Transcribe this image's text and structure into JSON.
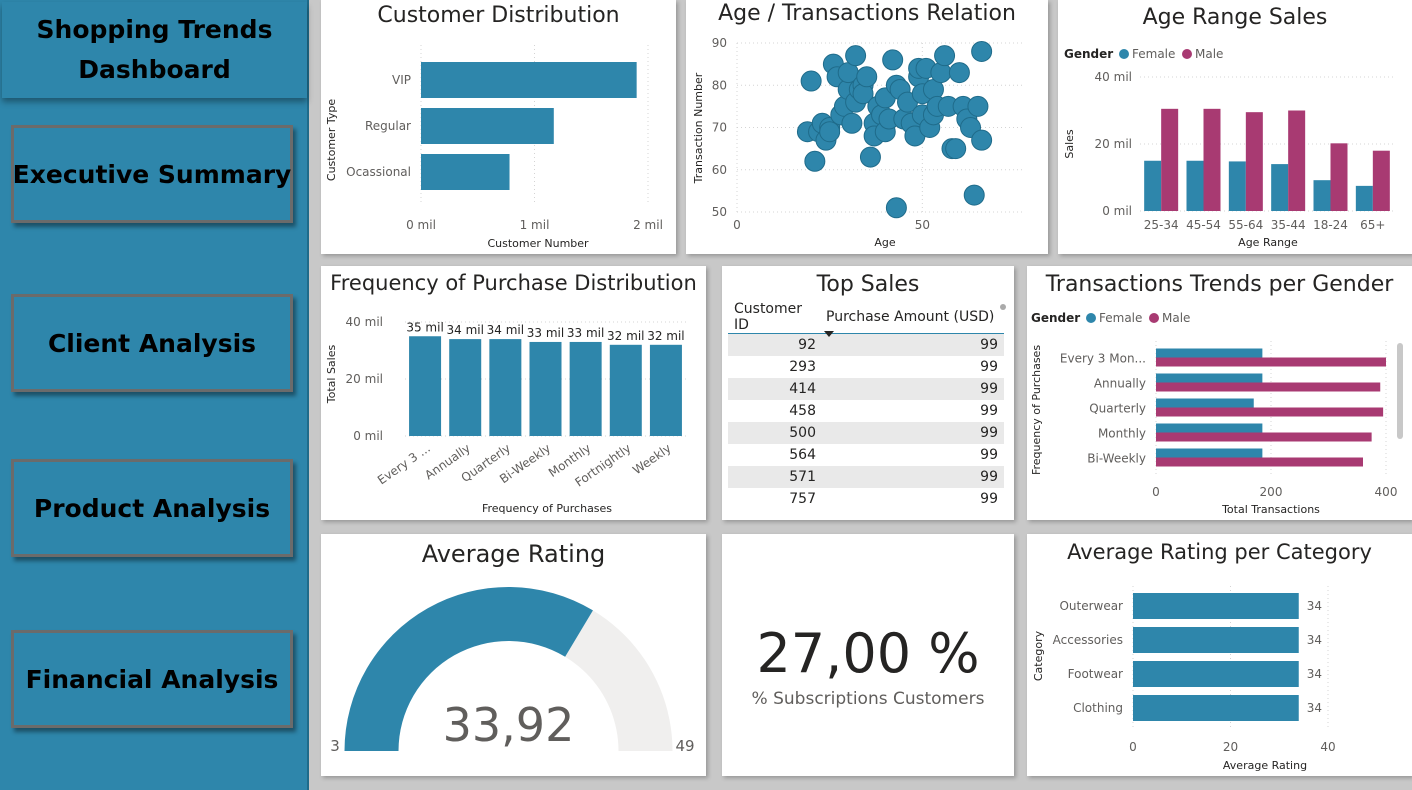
{
  "sidebar": {
    "title": "Shopping Trends\nDashboard",
    "nav": [
      {
        "label": "Executive Summary"
      },
      {
        "label": "Client Analysis"
      },
      {
        "label": "Product Analysis"
      },
      {
        "label": "Financial Analysis"
      }
    ]
  },
  "colors": {
    "primary": "#2e86ab",
    "male": "#a83a72",
    "female": "#2e86ab",
    "gauge_bg": "#f0efee"
  },
  "cards": {
    "customer_distribution": {
      "title": "Customer Distribution"
    },
    "age_transactions": {
      "title": "Age / Transactions Relation"
    },
    "age_range_sales": {
      "title": "Age Range Sales"
    },
    "frequency_purchase": {
      "title": "Frequency of Purchase Distribution"
    },
    "top_sales": {
      "title": "Top Sales",
      "columns": [
        "Customer ID",
        "Purchase Amount (USD)"
      ],
      "rows": [
        [
          "92",
          "99"
        ],
        [
          "293",
          "99"
        ],
        [
          "414",
          "99"
        ],
        [
          "458",
          "99"
        ],
        [
          "500",
          "99"
        ],
        [
          "564",
          "99"
        ],
        [
          "571",
          "99"
        ],
        [
          "757",
          "99"
        ]
      ]
    },
    "transactions_gender": {
      "title": "Transactions Trends per Gender"
    },
    "average_rating": {
      "title": "Average Rating",
      "value": "33,92",
      "min": "3",
      "max": "49"
    },
    "subscriptions": {
      "value": "27,00 %",
      "label": "% Subscriptions Customers"
    },
    "rating_category": {
      "title": "Average Rating per Category"
    }
  },
  "chart_data": [
    {
      "id": "customer_distribution",
      "type": "bar",
      "orientation": "horizontal",
      "categories": [
        "VIP",
        "Regular",
        "Ocassional"
      ],
      "values": [
        1.9,
        1.17,
        0.78
      ],
      "xlabel": "Customer Number",
      "ylabel": "Customer Type",
      "xticks": [
        "0 mil",
        "1 mil",
        "2 mil"
      ],
      "xlim": [
        0,
        2
      ]
    },
    {
      "id": "age_transactions",
      "type": "scatter",
      "xlabel": "Age",
      "ylabel": "Transaction Number",
      "xticks": [
        "0",
        "50"
      ],
      "yticks": [
        "50",
        "60",
        "70",
        "80",
        "90"
      ],
      "xlim": [
        0,
        75
      ],
      "ylim": [
        50,
        90
      ],
      "points": [
        [
          19,
          69
        ],
        [
          20,
          81
        ],
        [
          21,
          62
        ],
        [
          22,
          69
        ],
        [
          23,
          71
        ],
        [
          24,
          67
        ],
        [
          25,
          70
        ],
        [
          25,
          69
        ],
        [
          26,
          85
        ],
        [
          27,
          82
        ],
        [
          28,
          73
        ],
        [
          29,
          75
        ],
        [
          30,
          79
        ],
        [
          30,
          83
        ],
        [
          31,
          71
        ],
        [
          32,
          76
        ],
        [
          32,
          87
        ],
        [
          33,
          79
        ],
        [
          34,
          80
        ],
        [
          34,
          78
        ],
        [
          35,
          82
        ],
        [
          36,
          63
        ],
        [
          37,
          71
        ],
        [
          37,
          68
        ],
        [
          38,
          75
        ],
        [
          39,
          73
        ],
        [
          40,
          77
        ],
        [
          40,
          69
        ],
        [
          41,
          72
        ],
        [
          42,
          86
        ],
        [
          43,
          80
        ],
        [
          43,
          51
        ],
        [
          44,
          79
        ],
        [
          45,
          72
        ],
        [
          46,
          76
        ],
        [
          47,
          71
        ],
        [
          48,
          68
        ],
        [
          49,
          82
        ],
        [
          49,
          84
        ],
        [
          50,
          73
        ],
        [
          50,
          78
        ],
        [
          51,
          84
        ],
        [
          52,
          70
        ],
        [
          53,
          73
        ],
        [
          53,
          79
        ],
        [
          54,
          75
        ],
        [
          55,
          83
        ],
        [
          56,
          87
        ],
        [
          57,
          75
        ],
        [
          58,
          65
        ],
        [
          59,
          65
        ],
        [
          60,
          83
        ],
        [
          61,
          75
        ],
        [
          62,
          72
        ],
        [
          63,
          70
        ],
        [
          64,
          54
        ],
        [
          65,
          75
        ],
        [
          66,
          67
        ],
        [
          66,
          88
        ]
      ]
    },
    {
      "id": "age_range_sales",
      "type": "bar",
      "legend_title": "Gender",
      "legend": "top-left",
      "categories": [
        "25-34",
        "45-54",
        "55-64",
        "35-44",
        "18-24",
        "65+"
      ],
      "series": [
        {
          "name": "Female",
          "values": [
            15,
            15,
            14.8,
            14,
            9.2,
            7.5
          ]
        },
        {
          "name": "Male",
          "values": [
            30.5,
            30.5,
            29.5,
            30,
            20.2,
            18
          ]
        }
      ],
      "xlabel": "Age Range",
      "ylabel": "Sales",
      "yticks": [
        "0 mil",
        "20 mil",
        "40 mil"
      ],
      "ylim": [
        0,
        40
      ]
    },
    {
      "id": "frequency_purchase",
      "type": "bar",
      "categories": [
        "Every 3 ...",
        "Annually",
        "Quarterly",
        "Bi-Weekly",
        "Monthly",
        "Fortnightly",
        "Weekly"
      ],
      "values": [
        35,
        34,
        34,
        33,
        33,
        32,
        32
      ],
      "data_labels": [
        "35 mil",
        "34 mil",
        "34 mil",
        "33 mil",
        "33 mil",
        "32 mil",
        "32 mil"
      ],
      "xlabel": "Frequency of Purchases",
      "ylabel": "Total Sales",
      "yticks": [
        "0 mil",
        "20 mil",
        "40 mil"
      ],
      "ylim": [
        0,
        40
      ]
    },
    {
      "id": "transactions_gender",
      "type": "bar",
      "orientation": "horizontal",
      "legend_title": "Gender",
      "legend": "top-left",
      "categories": [
        "Every 3 Mon...",
        "Annually",
        "Quarterly",
        "Monthly",
        "Bi-Weekly"
      ],
      "series": [
        {
          "name": "Female",
          "values": [
            185,
            185,
            170,
            185,
            185
          ]
        },
        {
          "name": "Male",
          "values": [
            400,
            390,
            395,
            375,
            360
          ]
        }
      ],
      "xlabel": "Total Transactions",
      "ylabel": "Frequency of Purchases",
      "xticks": [
        "0",
        "200",
        "400"
      ],
      "xlim": [
        0,
        400
      ]
    },
    {
      "id": "average_rating",
      "type": "gauge",
      "value": 33.92,
      "min": 3,
      "max": 49
    },
    {
      "id": "rating_category",
      "type": "bar",
      "orientation": "horizontal",
      "categories": [
        "Outerwear",
        "Accessories",
        "Footwear",
        "Clothing"
      ],
      "values": [
        34,
        34,
        34,
        34
      ],
      "data_labels": [
        "34",
        "34",
        "34",
        "34"
      ],
      "xlabel": "Average Rating",
      "ylabel": "Category",
      "xticks": [
        "0",
        "20",
        "40"
      ],
      "xlim": [
        0,
        40
      ]
    }
  ]
}
